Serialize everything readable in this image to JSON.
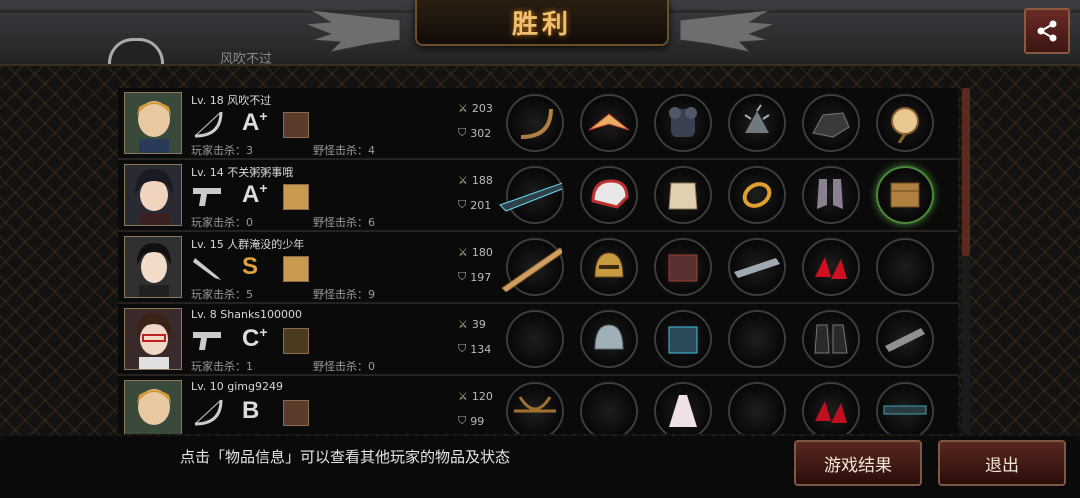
{
  "header": {
    "title": "胜利"
  },
  "previous_player": {
    "name": "风吹不过"
  },
  "players": [
    {
      "level_name": "Lv. 18  风吹不过",
      "grade": "A",
      "grade_plus": "+",
      "kills": "玩家击杀：3",
      "monster_kills": "野怪击杀：4",
      "attack": "203",
      "defense": "302",
      "weapon": "bow",
      "avatar": "blond-boy"
    },
    {
      "level_name": "Lv. 14  不关粥粥事哦",
      "grade": "A",
      "grade_plus": "+",
      "kills": "玩家击杀：0",
      "monster_kills": "野怪击杀：6",
      "attack": "188",
      "defense": "201",
      "weapon": "pistol",
      "avatar": "dark-hair-girl"
    },
    {
      "level_name": "Lv. 15  人群淹没的少年",
      "grade": "S",
      "grade_plus": "",
      "kills": "玩家击杀：5",
      "monster_kills": "野怪击杀：9",
      "attack": "180",
      "defense": "197",
      "weapon": "knife",
      "avatar": "black-hair-boy"
    },
    {
      "level_name": "Lv. 8    Shanks100000",
      "grade": "C",
      "grade_plus": "+",
      "kills": "玩家击杀：1",
      "monster_kills": "野怪击杀：0",
      "attack": "39",
      "defense": "134",
      "weapon": "pistol",
      "avatar": "glasses-girl"
    },
    {
      "level_name": "Lv. 10  gimg9249",
      "grade": "B",
      "grade_plus": "",
      "kills": "",
      "monster_kills": "",
      "attack": "120",
      "defense": "99",
      "weapon": "bow",
      "avatar": "blond-boy"
    }
  ],
  "footer": {
    "hint": "点击「物品信息」可以查看其他玩家的物品及状态",
    "results_button": "游戏结果",
    "exit_button": "退出"
  },
  "icons": {
    "share": "share-icon",
    "attack": "crossed-swords-icon",
    "defense": "shield-icon"
  },
  "colors": {
    "accent": "#f0c070",
    "button": "#5a2620"
  }
}
